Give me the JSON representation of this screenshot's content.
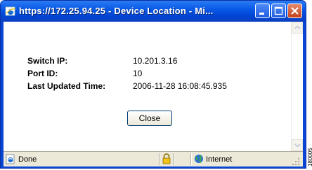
{
  "window": {
    "title": "https://172.25.94.25 - Device Location - Mi...",
    "colors": {
      "titlebar": "#0a5ae8",
      "close_button": "#c4411c",
      "statusbar": "#ece9d8"
    }
  },
  "details": [
    {
      "label": "Switch IP:",
      "value": "10.201.3.16"
    },
    {
      "label": "Port ID:",
      "value": "10"
    },
    {
      "label": "Last Updated Time:",
      "value": "2006-11-28 16:08:45.935"
    }
  ],
  "close_button": {
    "label": "Close"
  },
  "statusbar": {
    "status": "Done",
    "zone": "Internet",
    "icons": [
      "page-icon",
      "lock-icon",
      "globe-icon",
      "resize-grip-icon"
    ]
  },
  "figure_id": "180005"
}
